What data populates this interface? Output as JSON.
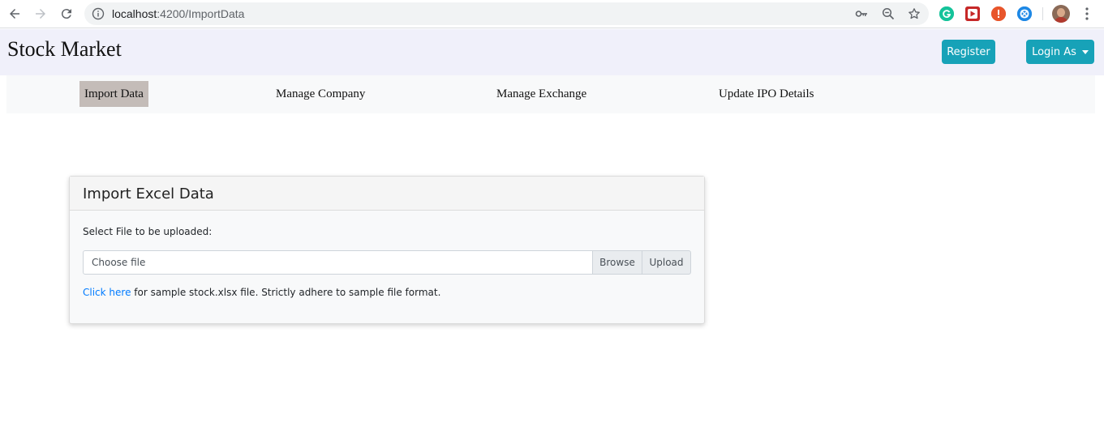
{
  "browser": {
    "url_host": "localhost",
    "url_path": ":4200/ImportData",
    "extensions": [
      "grammarly-icon",
      "video-extension-icon",
      "alert-extension-icon",
      "sync-extension-icon"
    ]
  },
  "header": {
    "brand": "Stock Market",
    "register_label": "Register",
    "login_label": "Login As"
  },
  "subnav": {
    "items": [
      {
        "label": "Import Data"
      },
      {
        "label": "Manage Company"
      },
      {
        "label": "Manage Exchange"
      },
      {
        "label": "Update IPO Details"
      }
    ]
  },
  "card": {
    "title": "Import Excel Data",
    "field_label": "Select File to be uploaded:",
    "file_placeholder": "Choose file",
    "browse_label": "Browse",
    "upload_label": "Upload",
    "help_link": "Click here",
    "help_text": " for sample stock.xlsx file. Strictly adhere to sample file format."
  },
  "colors": {
    "accent": "#17a2b8",
    "link": "#007bff",
    "active_tab": "#c4bcb8"
  }
}
